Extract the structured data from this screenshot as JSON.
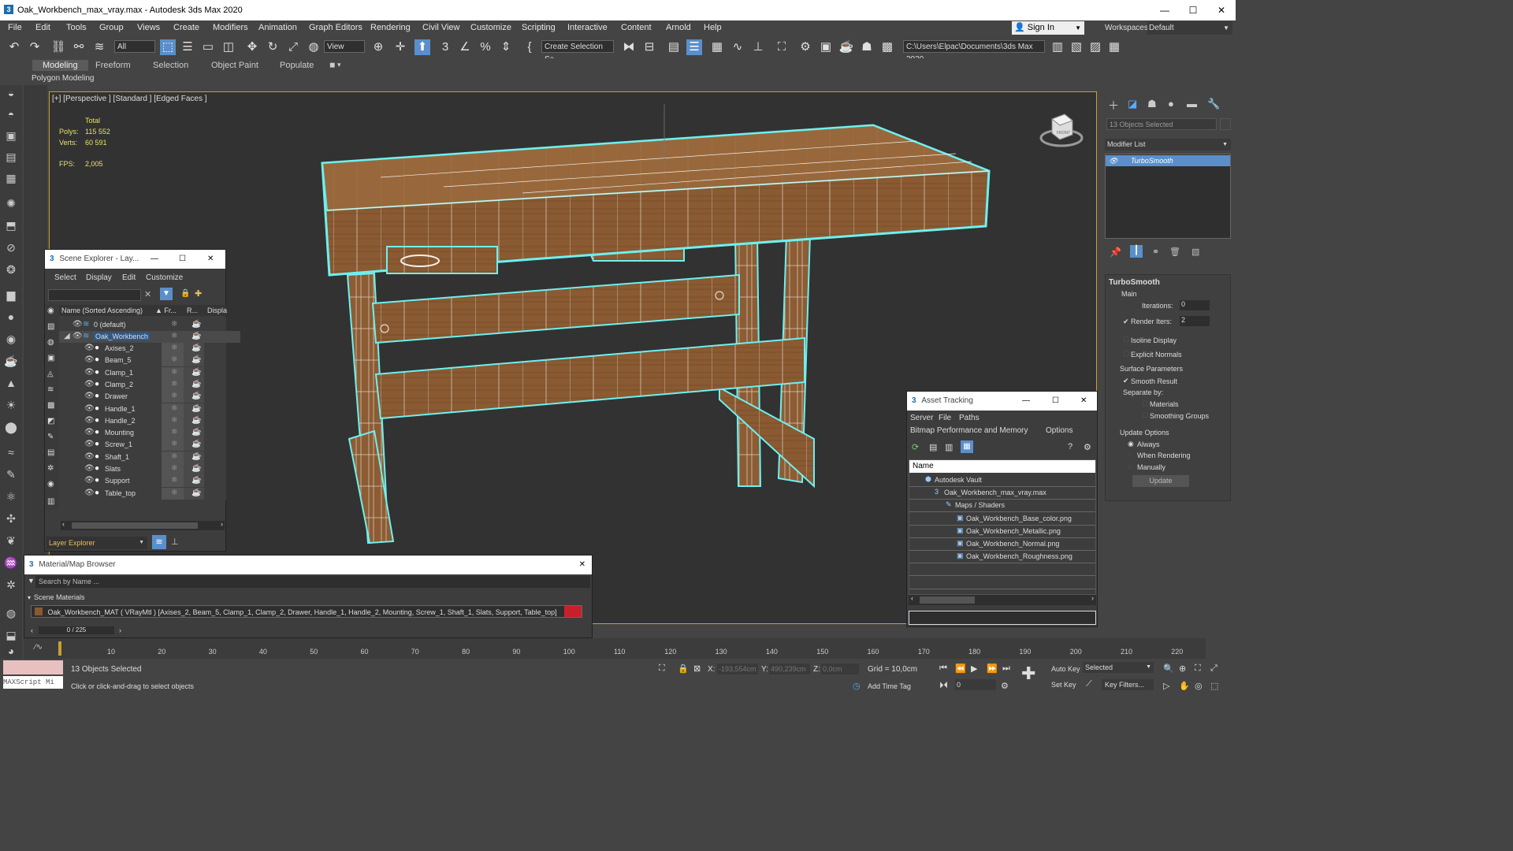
{
  "window": {
    "title": "Oak_Workbench_max_vray.max - Autodesk 3ds Max 2020",
    "app_icon": "3",
    "minimize": "—",
    "maximize": "☐",
    "close": "✕"
  },
  "menu": [
    "File",
    "Edit",
    "Tools",
    "Group",
    "Views",
    "Create",
    "Modifiers",
    "Animation",
    "Graph Editors",
    "Rendering",
    "Civil View",
    "Customize",
    "Scripting",
    "Interactive",
    "Content",
    "Arnold",
    "Help"
  ],
  "signin": "Sign In",
  "workspaces_label": "Workspaces:",
  "workspaces_value": "Default",
  "toolbar": {
    "filter": "All",
    "view": "View",
    "selection_set": "Create Selection Se",
    "path": "C:\\Users\\Elpac\\Documents\\3ds Max 2020"
  },
  "ribbon": {
    "tabs": [
      "Modeling",
      "Freeform",
      "Selection",
      "Object Paint",
      "Populate"
    ],
    "sub": "Polygon Modeling"
  },
  "viewport": {
    "label": "[+] [Perspective ] [Standard ] [Edged Faces ]",
    "stats": {
      "total": "Total",
      "polys_label": "Polys:",
      "polys": "115 552",
      "verts_label": "Verts:",
      "verts": "60 591",
      "fps_label": "FPS:",
      "fps": "2,005"
    },
    "viewcube": "FRONT"
  },
  "scene_explorer": {
    "title": "Scene Explorer - Lay...",
    "menu": [
      "Select",
      "Display",
      "Edit",
      "Customize"
    ],
    "columns": [
      "Name (Sorted Ascending)",
      "▲ Fr...",
      "R...",
      "Displa"
    ],
    "rows": [
      {
        "name": "0 (default)"
      },
      {
        "name": "Oak_Workbench"
      },
      {
        "name": "Axises_2"
      },
      {
        "name": "Beam_5"
      },
      {
        "name": "Clamp_1"
      },
      {
        "name": "Clamp_2"
      },
      {
        "name": "Drawer"
      },
      {
        "name": "Handle_1"
      },
      {
        "name": "Handle_2"
      },
      {
        "name": "Mounting"
      },
      {
        "name": "Screw_1"
      },
      {
        "name": "Shaft_1"
      },
      {
        "name": "Slats"
      },
      {
        "name": "Support"
      },
      {
        "name": "Table_top"
      }
    ],
    "footer": "Layer Explorer"
  },
  "material_browser": {
    "title": "Material/Map Browser",
    "search": "Search by Name ...",
    "section": "Scene Materials",
    "material": "Oak_Workbench_MAT ( VRayMtl ) [Axises_2, Beam_5, Clamp_1, Clamp_2, Drawer, Handle_1, Handle_2, Mounting, Screw_1, Shaft_1, Slats, Support, Table_top]"
  },
  "asset_tracking": {
    "title": "Asset Tracking",
    "menu": [
      "Server",
      "File",
      "Paths"
    ],
    "menu2": [
      "Bitmap Performance and Memory",
      "Options"
    ],
    "col_name": "Name",
    "items": [
      {
        "label": "Autodesk Vault"
      },
      {
        "label": "Oak_Workbench_max_vray.max"
      },
      {
        "label": "Maps / Shaders"
      },
      {
        "label": "Oak_Workbench_Base_color.png"
      },
      {
        "label": "Oak_Workbench_Metallic.png"
      },
      {
        "label": "Oak_Workbench_Normal.png"
      },
      {
        "label": "Oak_Workbench_Roughness.png"
      }
    ]
  },
  "command_panel": {
    "selected": "13 Objects Selected",
    "modifier_list": "Modifier List",
    "modifier": "TurboSmooth",
    "rollout": "TurboSmooth",
    "main": "Main",
    "iterations_label": "Iterations:",
    "iterations": "0",
    "render_iters_label": "Render Iters:",
    "render_iters": "2",
    "isoline": "Isoline Display",
    "explicit": "Explicit Normals",
    "surface": "Surface Parameters",
    "smooth_result": "Smooth Result",
    "separate": "Separate by:",
    "materials": "Materials",
    "smoothing_groups": "Smoothing Groups",
    "update_options": "Update Options",
    "always": "Always",
    "when_rendering": "When Rendering",
    "manually": "Manually",
    "update": "Update"
  },
  "timeline": {
    "frame": "0 / 225",
    "ticks": [
      "10",
      "20",
      "30",
      "40",
      "50",
      "60",
      "70",
      "80",
      "90",
      "100",
      "110",
      "120",
      "130",
      "140",
      "150",
      "160",
      "170",
      "180",
      "190",
      "200",
      "210",
      "220"
    ]
  },
  "status": {
    "maxscript": "MAXScript Mi",
    "selected": "13 Objects Selected",
    "prompt": "Click or click-and-drag to select objects",
    "x_label": "X:",
    "x": "-193,554cm",
    "y_label": "Y:",
    "y": "490,239cm",
    "z_label": "Z:",
    "z": "0,0cm",
    "grid": "Grid = 10,0cm",
    "add_time_tag": "Add Time Tag",
    "auto_key": "Auto Key",
    "set_key": "Set Key",
    "selected_dd": "Selected",
    "key_filters": "Key Filters...",
    "frame_field": "0"
  }
}
